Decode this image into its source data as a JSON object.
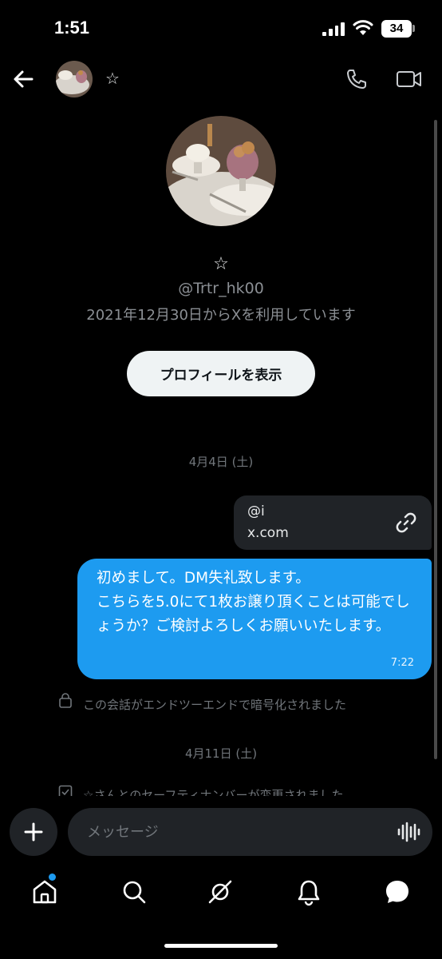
{
  "status_bar": {
    "time": "1:51",
    "battery": "34"
  },
  "header": {
    "contact_name": "☆"
  },
  "profile": {
    "name": "☆",
    "handle": "@Trtr_hk00",
    "joined": "2021年12月30日からXを利用しています",
    "view_profile_label": "プロフィールを表示"
  },
  "conversation": {
    "date_1": "4月4日 (土)",
    "link_card": {
      "title": "@i",
      "domain": "x.com"
    },
    "message": {
      "text": "初めまして。DM失礼致します。\nこちらを5.0にて1枚お譲り頂くことは可能でしょうか？ご検討よろしくお願いいたします。",
      "time": "7:22"
    },
    "encryption_notice": "この会話がエンドツーエンドで暗号化されました",
    "date_2": "4月11日 (土)",
    "safety_notice": "☆さんとのセーフティナンバーが変更されました"
  },
  "composer": {
    "placeholder": "メッセージ"
  },
  "colors": {
    "accent": "#1d9bf0",
    "background": "#000000",
    "card": "#202327",
    "muted": "#71767b"
  },
  "nav": {
    "items": [
      "home-icon",
      "search-icon",
      "grok-icon",
      "notifications-icon",
      "messages-icon"
    ]
  }
}
